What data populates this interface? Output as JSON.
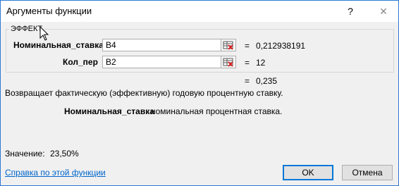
{
  "window": {
    "title": "Аргументы функции",
    "help_glyph": "?",
    "close_glyph": "✕"
  },
  "function_group": {
    "name": "ЭФФЕКТ",
    "args": [
      {
        "label": "Номинальная_ставка",
        "value": "B4",
        "equals": "=",
        "result": "0,212938191"
      },
      {
        "label": "Кол_пер",
        "value": "B2",
        "equals": "=",
        "result": "12"
      }
    ]
  },
  "formula_result": {
    "equals": "=",
    "value": "0,235"
  },
  "description": "Возвращает фактическую (эффективную) годовую процентную ставку.",
  "arg_description": {
    "name": "Номинальная_ставка",
    "text": "номинальная процентная ставка."
  },
  "value_display": {
    "label": "Значение:",
    "value": "23,50%"
  },
  "help_link": "Справка по этой функции",
  "buttons": {
    "ok": "OK",
    "cancel": "Отмена"
  },
  "icons": {
    "ref": "range-select-icon",
    "cursor": "mouse-pointer-icon"
  },
  "colors": {
    "accent": "#0078d7",
    "link": "#0066cc",
    "border": "#2b79d4"
  }
}
